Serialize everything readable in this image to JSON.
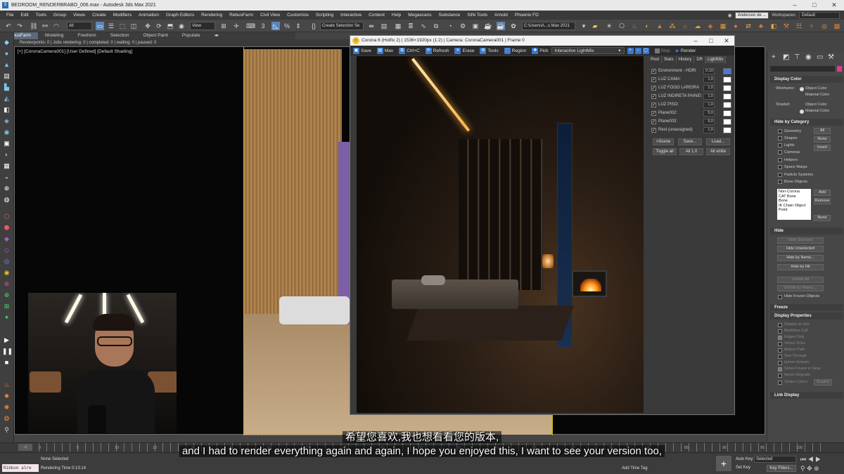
{
  "window": {
    "title": "BEDROOM_RENDERBRABO_006.max - Autodesk 3ds Max 2021"
  },
  "menu": [
    "File",
    "Edit",
    "Tools",
    "Group",
    "Views",
    "Create",
    "Modifiers",
    "Animation",
    "Graph Editors",
    "Rendering",
    "RebusFarm",
    "Civil View",
    "Customize",
    "Scripting",
    "Interactive",
    "Content",
    "Help",
    "Megascans",
    "Substance",
    "SiNi Tools",
    "Arnold",
    "Phoenix FD"
  ],
  "user": {
    "name": "Anderson de ...",
    "workspaces_label": "Workspaces:",
    "workspace_value": "Default"
  },
  "toolbar": {
    "filter_value": "All",
    "view_value": "View",
    "selection_set_placeholder": "Create Selection Se",
    "path_value": "C:\\Users\\A...s Max 2021"
  },
  "ribbon_tabs": [
    "RebusFarm",
    "Modeling",
    "Freeform",
    "Selection",
    "Object Paint",
    "Populate"
  ],
  "status_line": "Renderpoints: 0 | Jobs rendering: 0 | completed: 0 | waiting: 0 | paused: 0",
  "viewport": {
    "label": "[+] [CoronaCamera001] [User Defined] [Default Shading]"
  },
  "corona": {
    "title": "Corona 6 (Hotfix 2) | 1536×1920px (1:2) | Camera: CoronaCamera001 | Frame 0",
    "toolbar": [
      "Save",
      "Max",
      "Ctrl+C",
      "Refresh",
      "Erase",
      "Tools",
      "Region",
      "Pick"
    ],
    "lightmix_label": "Interactive LightMix",
    "stop_label": "Stop",
    "render_label": "Render",
    "tabs": [
      "Post",
      "Stats",
      "History",
      "DR",
      "LightMix"
    ],
    "lights": [
      {
        "name": "Environment - HDRI",
        "value": "0,10",
        "color": "#4a78d8"
      },
      {
        "name": "LUZ CAMA:",
        "value": "1,0",
        "color": "#ffffff"
      },
      {
        "name": "LUZ FOGO LAREIRA",
        "value": "1,0",
        "color": "#ffffff"
      },
      {
        "name": "LUZ INDIRETA PAINEI",
        "value": "1,0",
        "color": "#ffffff"
      },
      {
        "name": "LUZ PISO:",
        "value": "1,0",
        "color": "#ffffff"
      },
      {
        "name": "Plane002:",
        "value": "5,0",
        "color": "#ffffff"
      },
      {
        "name": "Plane003:",
        "value": "5,0",
        "color": "#ffffff"
      },
      {
        "name": "Rest (unassigned)",
        "value": "1,0",
        "color": "#ffffff"
      }
    ],
    "buttons": {
      "scene": ">Scene",
      "save": "Save...",
      "load": "Load...",
      "toggle_all": "Toggle all",
      "all_one": "All 1.0",
      "all_white": "All white"
    }
  },
  "cmd": {
    "display_color": {
      "title": "Display Color",
      "wireframe": "Wireframe:",
      "shaded": "Shaded:",
      "object_color": "Object Color",
      "material_color": "Material Color"
    },
    "hide_by_category": {
      "title": "Hide by Category",
      "items": [
        "Geometry",
        "Shapes",
        "Lights",
        "Cameras",
        "Helpers",
        "Space Warps",
        "Particle Systems",
        "Bone Objects"
      ],
      "all": "All",
      "none": "None",
      "invert": "Invert",
      "list": [
        "Non-Corona",
        "CAT Bone",
        "Bone",
        "IK Chain Object",
        "Point"
      ],
      "add": "Add",
      "remove": "Remove",
      "none2": "None"
    },
    "hide": {
      "title": "Hide",
      "buttons": [
        "Hide Selected",
        "Hide Unselected",
        "Hide by Name...",
        "Hide by Hit",
        "Unhide All",
        "Unhide by Name...."
      ],
      "hide_frozen": "Hide Frozen Objects"
    },
    "freeze": {
      "title": "Freeze"
    },
    "display_properties": {
      "title": "Display Properties",
      "items": [
        "Display as box",
        "Backface Cull",
        "Edges Only",
        "Vertex Ticks",
        "Motion Path",
        "See-Through",
        "Ignore Extents",
        "Show Frozen in Gray",
        "Never Degrade",
        "Vertex Colors"
      ],
      "shaded": "Shaded"
    },
    "link_display": {
      "title": "Link Display"
    }
  },
  "timeline": {
    "ticks": [
      "0",
      "5",
      "10",
      "15",
      "20",
      "25",
      "30",
      "35",
      "40",
      "45",
      "50",
      "55",
      "60",
      "65",
      "70",
      "75",
      "80",
      "85",
      "90",
      "95",
      "100"
    ],
    "frame": "0 / 100"
  },
  "statusbar": {
    "selection": "None Selected",
    "render_time": "Rendering Time  0:13:14",
    "maxscript": "Ribbon alre",
    "auto_key": "Auto Key",
    "set_key": "Set Key",
    "selected": "Selected",
    "key_filters": "Key Filters...",
    "add_time_tag": "Add Time Tag"
  },
  "subtitles": {
    "cn": "希望您喜欢,我也想看看您的版本,",
    "en": "and I had to render everything again and again, I hope you enjoyed this, I want to see your version too,"
  }
}
